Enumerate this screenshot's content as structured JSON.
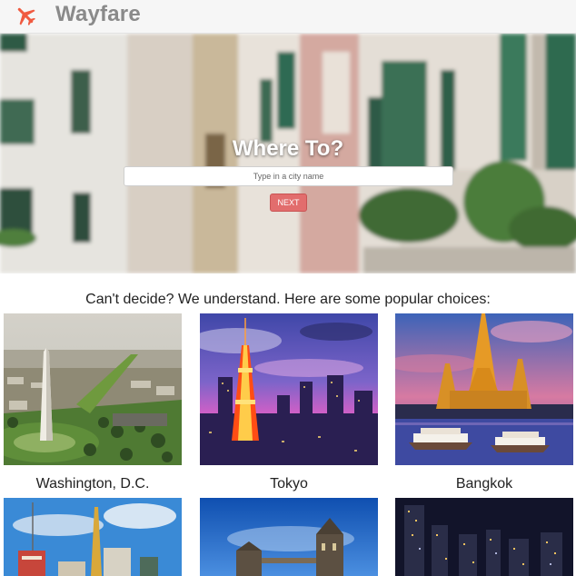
{
  "app": {
    "brand": "Wayfare",
    "logo": "airplane-icon",
    "accent": "#f05a40"
  },
  "hero": {
    "title": "Where To?",
    "search_placeholder": "Type in a city name",
    "search_value": "",
    "next_label": "NEXT"
  },
  "popular": {
    "heading": "Can't decide? We understand. Here are some popular choices:",
    "choices": [
      {
        "label": "Washington, D.C."
      },
      {
        "label": "Tokyo"
      },
      {
        "label": "Bangkok"
      },
      {
        "label": ""
      },
      {
        "label": ""
      },
      {
        "label": ""
      }
    ]
  }
}
